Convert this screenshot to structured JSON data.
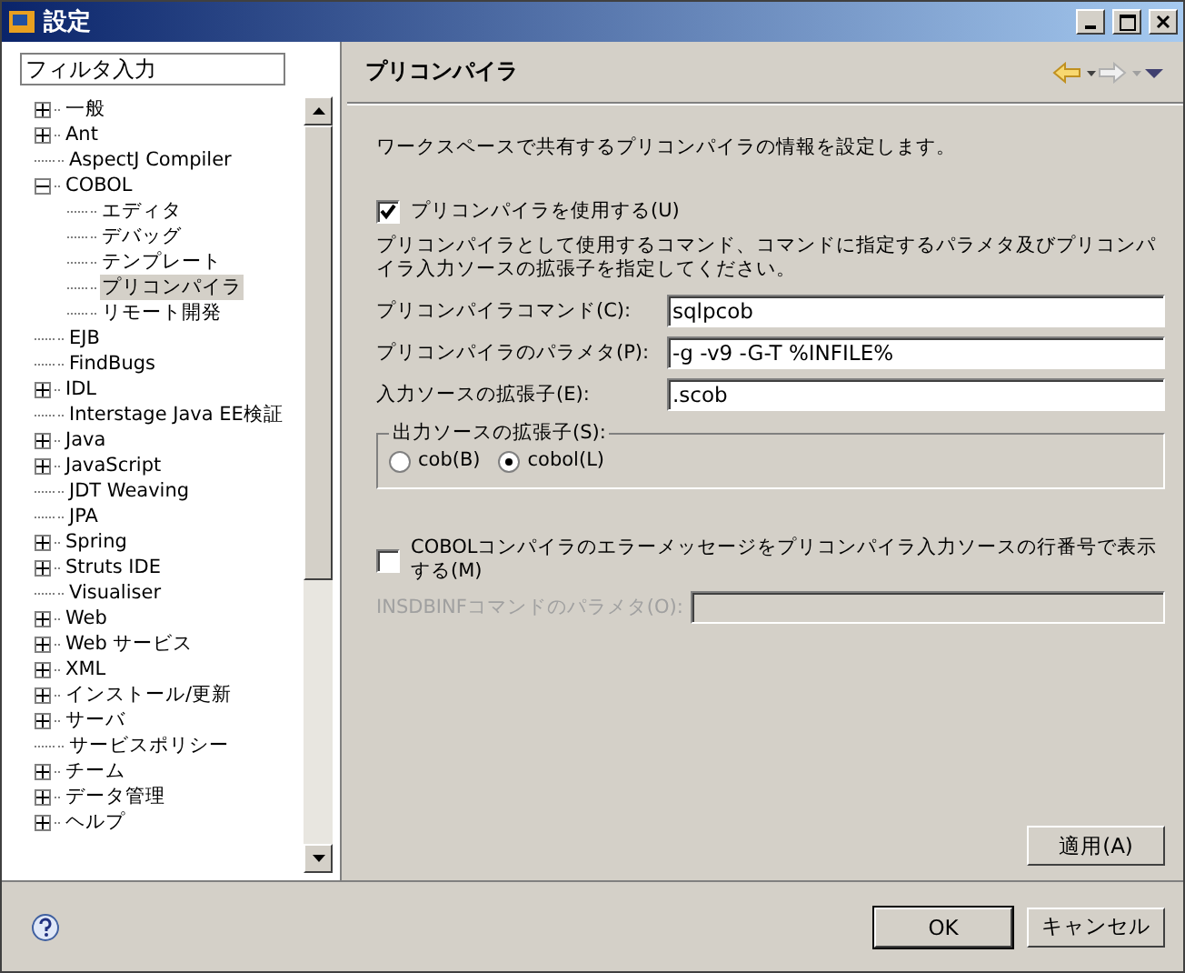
{
  "window": {
    "title": "設定"
  },
  "filter": {
    "placeholder": "フィルタ入力"
  },
  "tree": [
    {
      "label": "一般",
      "expanded": false,
      "selected": false
    },
    {
      "label": "Ant",
      "expanded": false,
      "selected": false
    },
    {
      "label": "AspectJ Compiler",
      "selected": false
    },
    {
      "label": "COBOL",
      "expanded": true,
      "selected": false,
      "children": [
        {
          "label": "エディタ",
          "selected": false
        },
        {
          "label": "デバッグ",
          "selected": false
        },
        {
          "label": "テンプレート",
          "selected": false
        },
        {
          "label": "プリコンパイラ",
          "selected": true
        },
        {
          "label": "リモート開発",
          "selected": false
        }
      ]
    },
    {
      "label": "EJB",
      "selected": false
    },
    {
      "label": "FindBugs",
      "selected": false
    },
    {
      "label": "IDL",
      "expanded": false,
      "selected": false
    },
    {
      "label": "Interstage Java EE検証",
      "selected": false
    },
    {
      "label": "Java",
      "expanded": false,
      "selected": false
    },
    {
      "label": "JavaScript",
      "expanded": false,
      "selected": false
    },
    {
      "label": "JDT Weaving",
      "selected": false
    },
    {
      "label": "JPA",
      "selected": false
    },
    {
      "label": "Spring",
      "expanded": false,
      "selected": false
    },
    {
      "label": "Struts IDE",
      "expanded": false,
      "selected": false
    },
    {
      "label": "Visualiser",
      "selected": false
    },
    {
      "label": "Web",
      "expanded": false,
      "selected": false
    },
    {
      "label": "Web サービス",
      "expanded": false,
      "selected": false
    },
    {
      "label": "XML",
      "expanded": false,
      "selected": false
    },
    {
      "label": "インストール/更新",
      "expanded": false,
      "selected": false
    },
    {
      "label": "サーバ",
      "expanded": false,
      "selected": false
    },
    {
      "label": "サービスポリシー",
      "selected": false
    },
    {
      "label": "チーム",
      "expanded": false,
      "selected": false
    },
    {
      "label": "データ管理",
      "expanded": false,
      "selected": false
    },
    {
      "label": "ヘルプ",
      "expanded": false,
      "selected": false
    }
  ],
  "page": {
    "title": "プリコンパイラ",
    "description": "ワークスペースで共有するプリコンパイラの情報を設定します。",
    "use_precompiler": {
      "label": "プリコンパイラを使用する(U)",
      "checked": true
    },
    "instructions": "プリコンパイラとして使用するコマンド、コマンドに指定するパラメタ及びプリコンパイラ入力ソースの拡張子を指定してください。",
    "fields": [
      {
        "label": "プリコンパイラコマンド(C):",
        "value": "sqlpcob",
        "disabled": false
      },
      {
        "label": "プリコンパイラのパラメタ(P):",
        "value": "-g -v9 -G-T %INFILE%",
        "disabled": false
      },
      {
        "label": "入力ソースの拡張子(E):",
        "value": ".scob",
        "disabled": false
      }
    ],
    "output_ext": {
      "label": "出力ソースの拡張子(S):",
      "options": [
        {
          "label": "cob(B)",
          "selected": false
        },
        {
          "label": "cobol(L)",
          "selected": true
        }
      ]
    },
    "line_numbers": {
      "label": "COBOLコンパイラのエラーメッセージをプリコンパイラ入力ソースの行番号で表示する(M)",
      "checked": false
    },
    "insdbinf": {
      "label": "INSDBINFコマンドのパラメタ(O):",
      "disabled": true
    },
    "apply": "適用(A)"
  },
  "buttons": [
    {
      "label": "OK",
      "default": true
    },
    {
      "label": "キャンセル",
      "default": false
    }
  ]
}
